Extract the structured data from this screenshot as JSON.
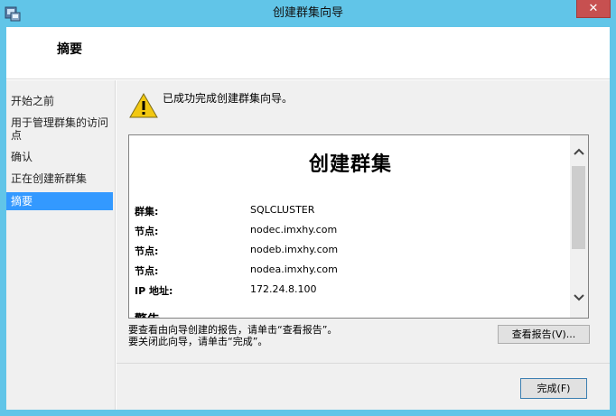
{
  "window": {
    "title": "创建群集向导",
    "close_label": "✕",
    "accent_color": "#61c5e8"
  },
  "header": {
    "title": "摘要"
  },
  "nav": {
    "items": [
      {
        "label": "开始之前"
      },
      {
        "label": "用于管理群集的访问点"
      },
      {
        "label": "确认"
      },
      {
        "label": "正在创建新群集"
      },
      {
        "label": "摘要"
      }
    ],
    "selected_index": 4,
    "selected_color": "#3399ff"
  },
  "status": {
    "icon": "warning-icon",
    "text": "已成功完成创建群集向导。"
  },
  "report": {
    "title": "创建群集",
    "rows": [
      {
        "label": "群集:",
        "value": "SQLCLUSTER"
      },
      {
        "label": "节点:",
        "value": "nodec.imxhy.com"
      },
      {
        "label": "节点:",
        "value": "nodeb.imxhy.com"
      },
      {
        "label": "节点:",
        "value": "nodea.imxhy.com"
      },
      {
        "label": "IP 地址:",
        "value": "172.24.8.100"
      }
    ],
    "cutoff_text": "警告"
  },
  "hints": {
    "line1": "要查看由向导创建的报告，请单击“查看报告”。",
    "line2": "要关闭此向导，请单击“完成”。"
  },
  "buttons": {
    "view_report": "查看报告(V)...",
    "finish": "完成(F)"
  }
}
